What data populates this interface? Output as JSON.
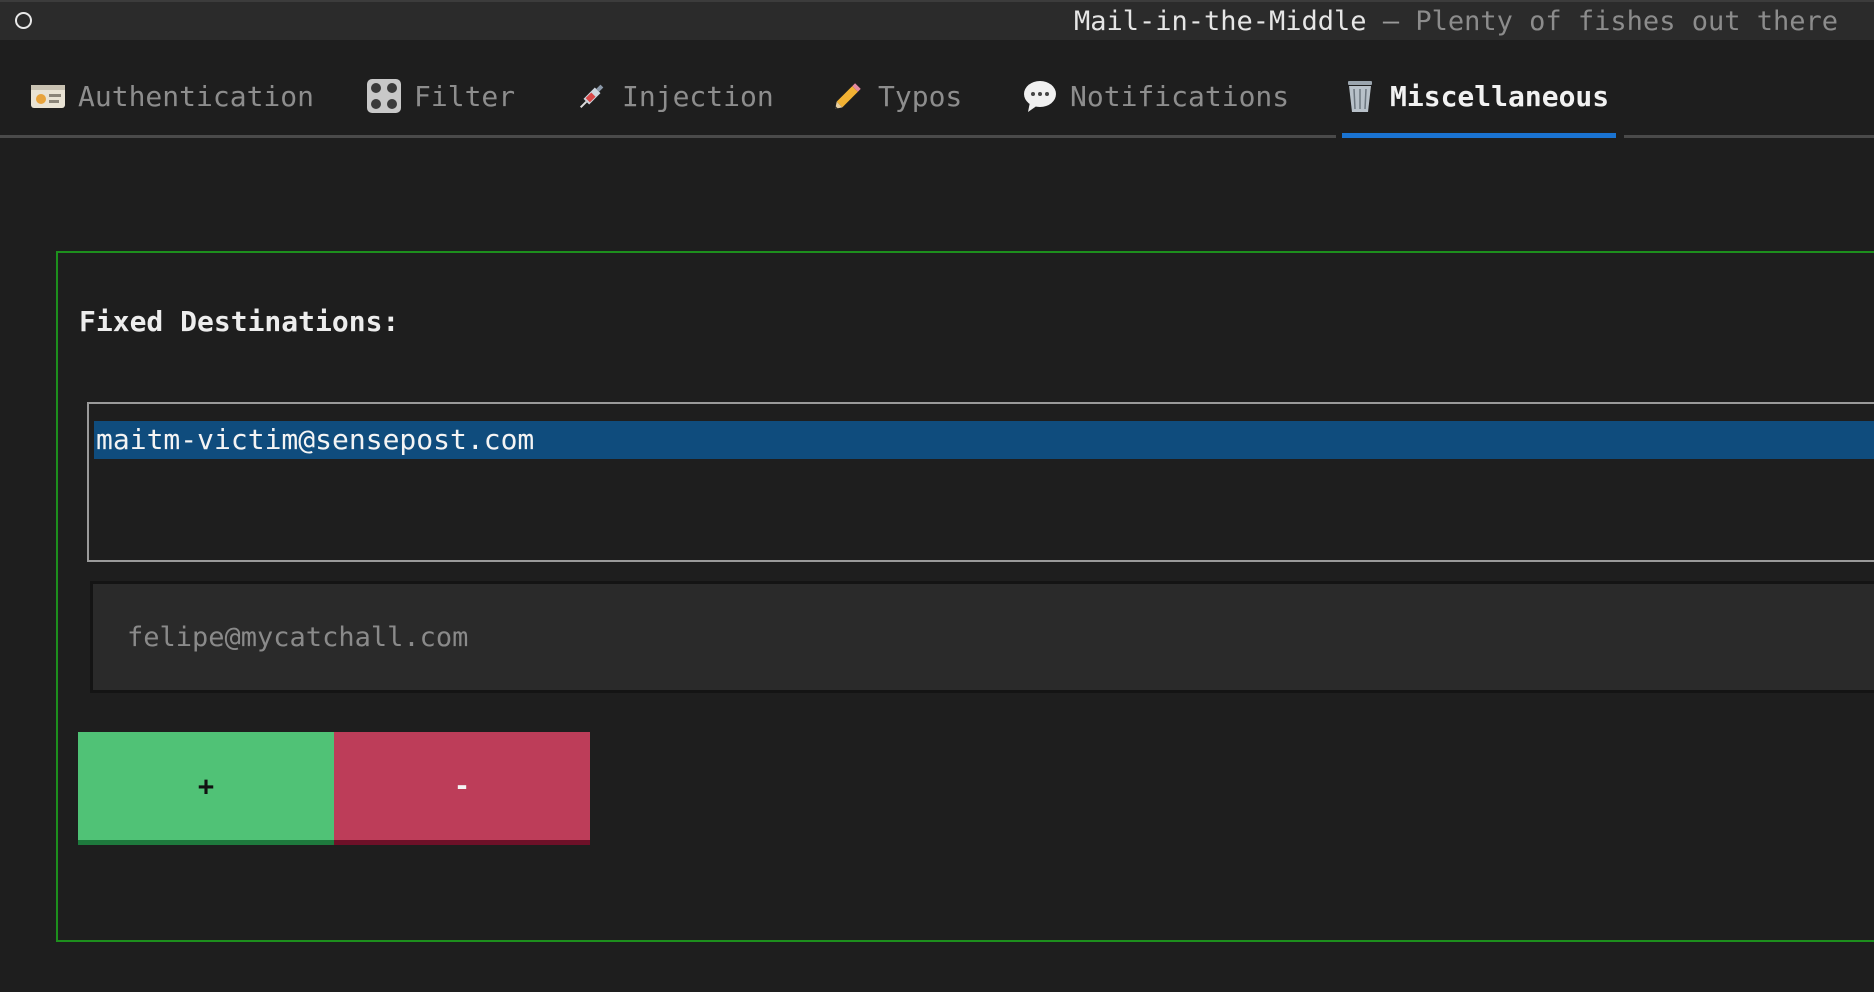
{
  "window": {
    "app_name": "Mail-in-the-Middle",
    "separator": " – ",
    "subtitle": "Plenty of fishes out there"
  },
  "tabs": [
    {
      "label": "Authentication",
      "icon": "id-card-icon",
      "active": false
    },
    {
      "label": "Filter",
      "icon": "control-knobs-icon",
      "active": false
    },
    {
      "label": "Injection",
      "icon": "syringe-icon",
      "active": false
    },
    {
      "label": "Typos",
      "icon": "pencil-icon",
      "active": false
    },
    {
      "label": "Notifications",
      "icon": "speech-bubble-icon",
      "active": false
    },
    {
      "label": "Miscellaneous",
      "icon": "wastebasket-icon",
      "active": true
    }
  ],
  "colors": {
    "accent": "#1a73d1",
    "panel_border": "#1d8f1d",
    "selection": "#0f4c7d",
    "add_button": "#50c276",
    "remove_button": "#bd3d59"
  },
  "main": {
    "section_label": "Fixed Destinations:",
    "destinations": [
      "maitm-victim@sensepost.com"
    ],
    "input_value": "",
    "input_placeholder": "felipe@mycatchall.com",
    "add_label": "+",
    "remove_label": "-"
  }
}
